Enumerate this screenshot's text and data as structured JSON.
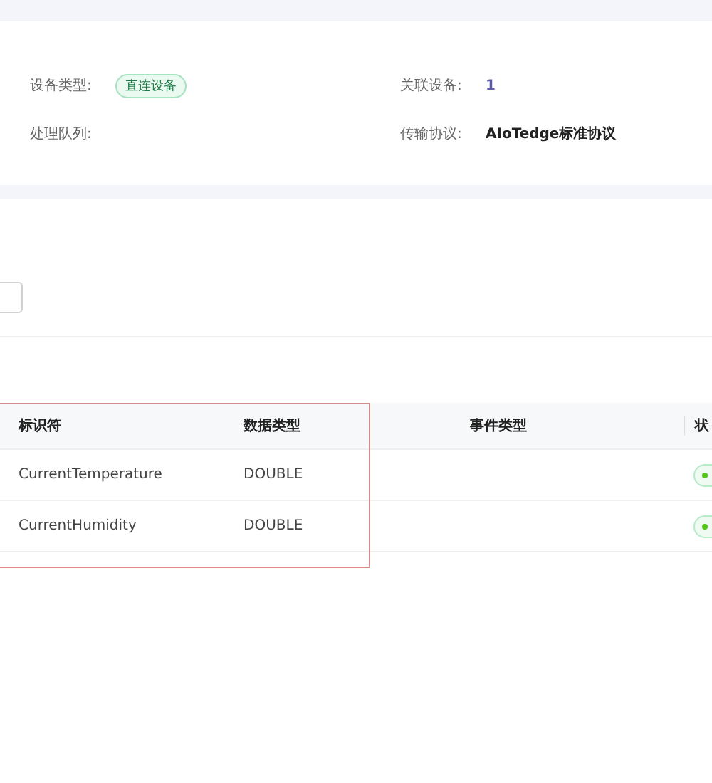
{
  "device_info": [
    {
      "label": "设备类型:",
      "value": "直连设备",
      "kind": "tag"
    },
    {
      "label": "关联设备:",
      "value": "1",
      "kind": "link"
    },
    {
      "label": "处理队列:",
      "kind": "text"
    },
    {
      "label": "传输协议:",
      "value": "AIoTedge标准协议",
      "kind": "text"
    }
  ],
  "table": {
    "columns": [
      "标识符",
      "数据类型",
      "事件类型",
      "状"
    ],
    "rows": [
      {
        "identifier": "CurrentTemperature",
        "data_type": "DOUBLE",
        "color": "#52c41a"
      },
      {
        "identifier": "CurrentHumidity",
        "data_type": "DOUBLE",
        "color": "#52c41a"
      }
    ]
  }
}
